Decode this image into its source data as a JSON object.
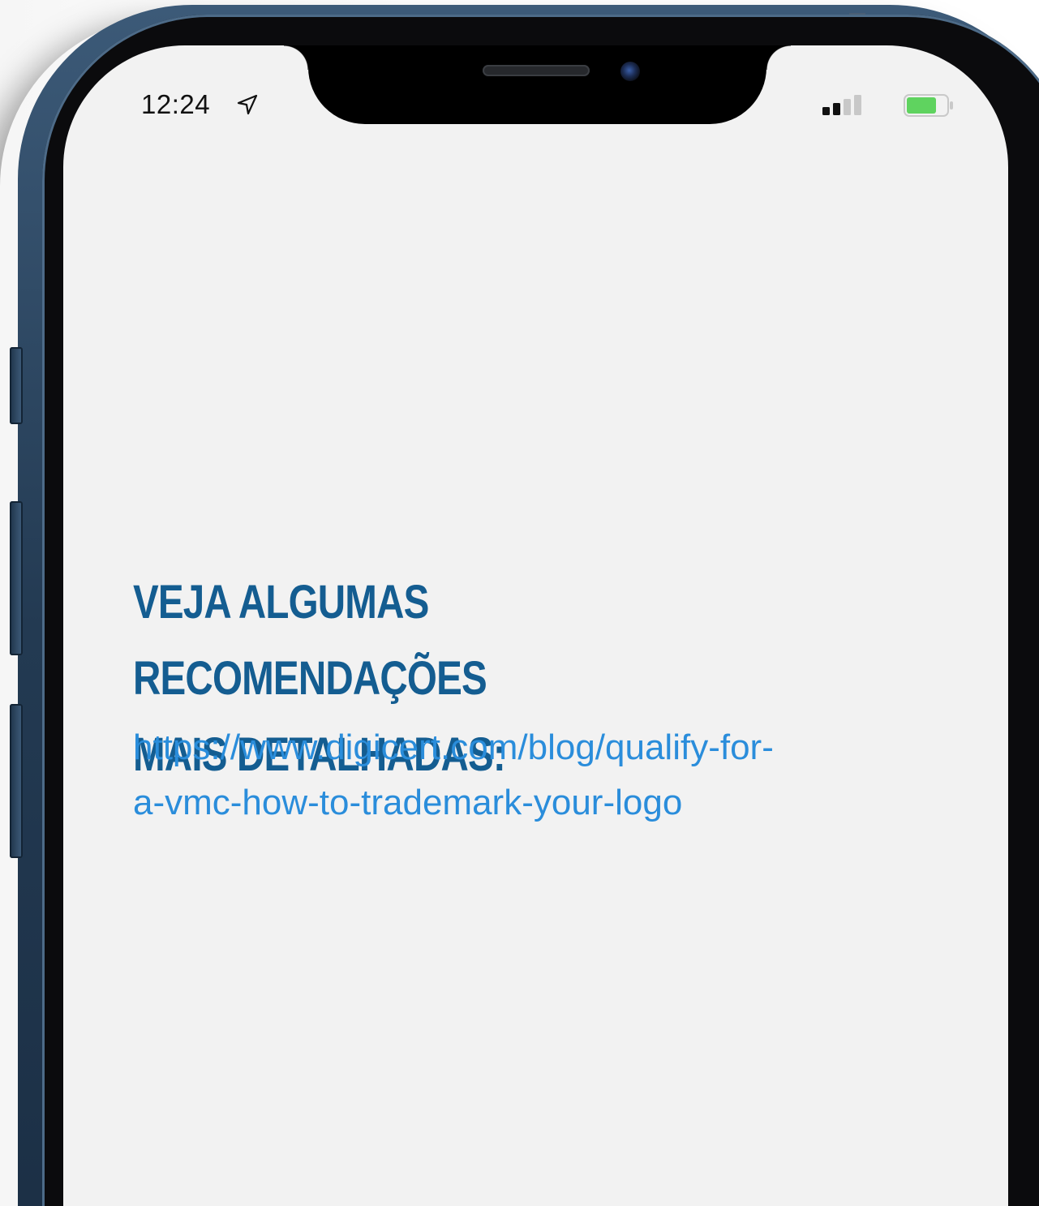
{
  "status_bar": {
    "time": "12:24",
    "location_icon": "location-arrow-icon",
    "signal_icon": "cellular-signal-icon",
    "battery_icon": "battery-icon",
    "battery_color": "#5fd35f"
  },
  "content": {
    "heading_line1": "VEJA ALGUMAS RECOMENDAÇÕES",
    "heading_line2": "MAIS DETALHADAS:",
    "link_line1": "https://www.digicert.com/blog/qualify-for-",
    "link_line2": "a-vmc-how-to-trademark-your-logo"
  },
  "colors": {
    "heading": "#145d91",
    "link": "#2a8ddb",
    "screen_background": "#f2f2f2",
    "frame": "#233a52"
  }
}
